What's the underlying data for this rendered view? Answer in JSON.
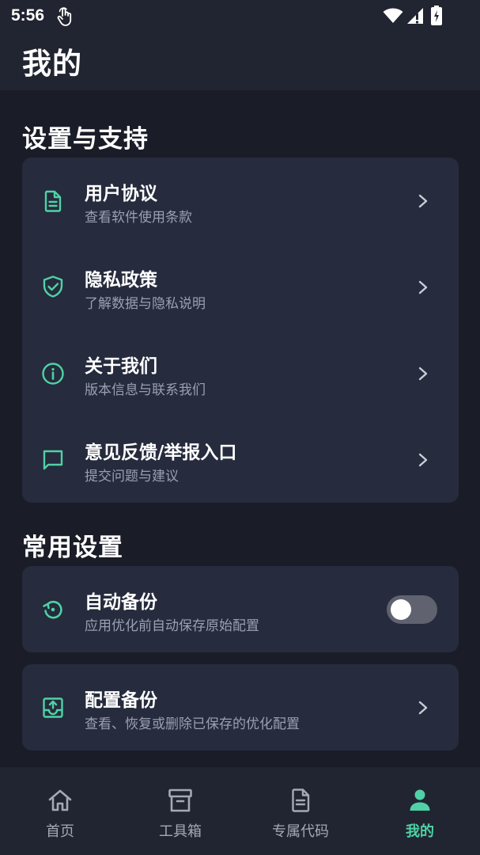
{
  "status_bar": {
    "time": "5:56"
  },
  "header": {
    "title": "我的"
  },
  "sections": {
    "support": {
      "title": "设置与支持",
      "items": [
        {
          "title": "用户协议",
          "subtitle": "查看软件使用条款",
          "icon": "document-icon"
        },
        {
          "title": "隐私政策",
          "subtitle": "了解数据与隐私说明",
          "icon": "shield-check-icon"
        },
        {
          "title": "关于我们",
          "subtitle": "版本信息与联系我们",
          "icon": "info-icon"
        },
        {
          "title": "意见反馈/举报入口",
          "subtitle": "提交问题与建议",
          "icon": "chat-icon"
        }
      ]
    },
    "common": {
      "title": "常用设置",
      "auto_backup": {
        "title": "自动备份",
        "subtitle": "应用优化前自动保存原始配置",
        "enabled": false,
        "icon": "restore-icon"
      },
      "config_backup": {
        "title": "配置备份",
        "subtitle": "查看、恢复或删除已保存的优化配置",
        "icon": "backup-upload-icon"
      }
    }
  },
  "bottom_nav": {
    "items": [
      {
        "label": "首页",
        "icon": "home-icon",
        "active": false
      },
      {
        "label": "工具箱",
        "icon": "archive-box-icon",
        "active": false
      },
      {
        "label": "专属代码",
        "icon": "file-code-icon",
        "active": false
      },
      {
        "label": "我的",
        "icon": "person-icon",
        "active": true
      }
    ]
  },
  "colors": {
    "background": "#1a1c27",
    "surface": "#262b3d",
    "header": "#212531",
    "accent": "#4fd1a5",
    "subtitle": "#9aa0b2"
  }
}
